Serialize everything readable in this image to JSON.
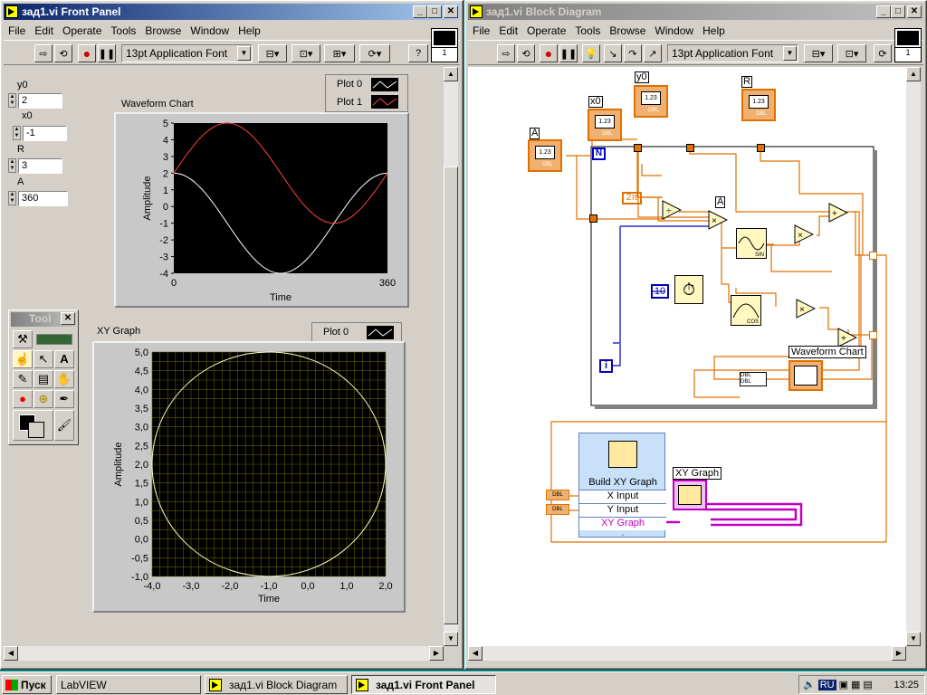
{
  "front_panel": {
    "title": "зад1.vi Front Panel",
    "menu": [
      "File",
      "Edit",
      "Operate",
      "Tools",
      "Browse",
      "Window",
      "Help"
    ],
    "font": "13pt Application Font",
    "page_number": "1",
    "controls": [
      {
        "label": "y0",
        "value": "2"
      },
      {
        "label": "x0",
        "value": "-1"
      },
      {
        "label": "R",
        "value": "3"
      },
      {
        "label": "A",
        "value": "360"
      }
    ],
    "waveform_legend": [
      "Plot 0",
      "Plot 1"
    ],
    "xy_legend": "Plot 0",
    "tools_title": "Tool"
  },
  "block_diagram": {
    "title": "зад1.vi Block Diagram",
    "menu": [
      "File",
      "Edit",
      "Operate",
      "Tools",
      "Browse",
      "Window",
      "Help"
    ],
    "font": "13pt Application Font",
    "page_number": "1",
    "terminals": {
      "A": "A",
      "x0": "x0",
      "y0": "y0",
      "R": "R",
      "dbl": "DBL",
      "num": "1.23"
    },
    "loop_n": "N",
    "loop_i": "i",
    "const_2pi": "2π",
    "const_10": "10",
    "node_a": "A",
    "sin_label": "SIN",
    "cos_label": "COS",
    "waveform_chart": "Waveform Chart",
    "xy_graph": "XY Graph",
    "build_xy": {
      "title": "Build XY Graph",
      "x": "X Input",
      "y": "Y Input",
      "out": "XY Graph"
    }
  },
  "taskbar": {
    "start": "Пуск",
    "tasks": [
      "LabVIEW",
      "зад1.vi Block Diagram",
      "зад1.vi Front Panel"
    ],
    "lang": "RU",
    "time": "13:25"
  },
  "chart_data": [
    {
      "type": "line",
      "title": "Waveform Chart",
      "xlabel": "Time",
      "ylabel": "Amplitude",
      "xlim": [
        0,
        360
      ],
      "ylim": [
        -4,
        5
      ],
      "xticks": [
        "0",
        "360"
      ],
      "yticks": [
        "5",
        "4",
        "3",
        "2",
        "1",
        "0",
        "-1",
        "-2",
        "-3",
        "-4"
      ],
      "series": [
        {
          "name": "Plot 0",
          "color": "#ffffff",
          "x": [
            0,
            45,
            90,
            135,
            180,
            225,
            270,
            315,
            360
          ],
          "values": [
            2,
            1.18,
            -1,
            -3.18,
            -4,
            -3.12,
            -1,
            1.12,
            2
          ]
        },
        {
          "name": "Plot 1",
          "color": "#ff4040",
          "x": [
            0,
            45,
            90,
            135,
            180,
            225,
            270,
            315,
            360
          ],
          "values": [
            2,
            4.12,
            5,
            4.12,
            2,
            -0.12,
            -1,
            -0.12,
            2
          ]
        }
      ]
    },
    {
      "type": "line",
      "title": "XY Graph",
      "xlabel": "Time",
      "ylabel": "Amplitude",
      "xlim": [
        -4,
        2
      ],
      "ylim": [
        -1,
        5
      ],
      "xticks": [
        "-4,0",
        "-3,0",
        "-2,0",
        "-1,0",
        "0,0",
        "1,0",
        "2,0"
      ],
      "yticks": [
        "5,0",
        "4,5",
        "4,0",
        "3,5",
        "3,0",
        "2,5",
        "2,0",
        "1,5",
        "1,0",
        "0,5",
        "0,0",
        "-0,5",
        "-1,0"
      ],
      "series": [
        {
          "name": "Plot 0",
          "color": "#ffffc0",
          "shape": "circle",
          "center": [
            -1,
            2
          ],
          "radius": 3
        }
      ],
      "grid": true
    }
  ]
}
